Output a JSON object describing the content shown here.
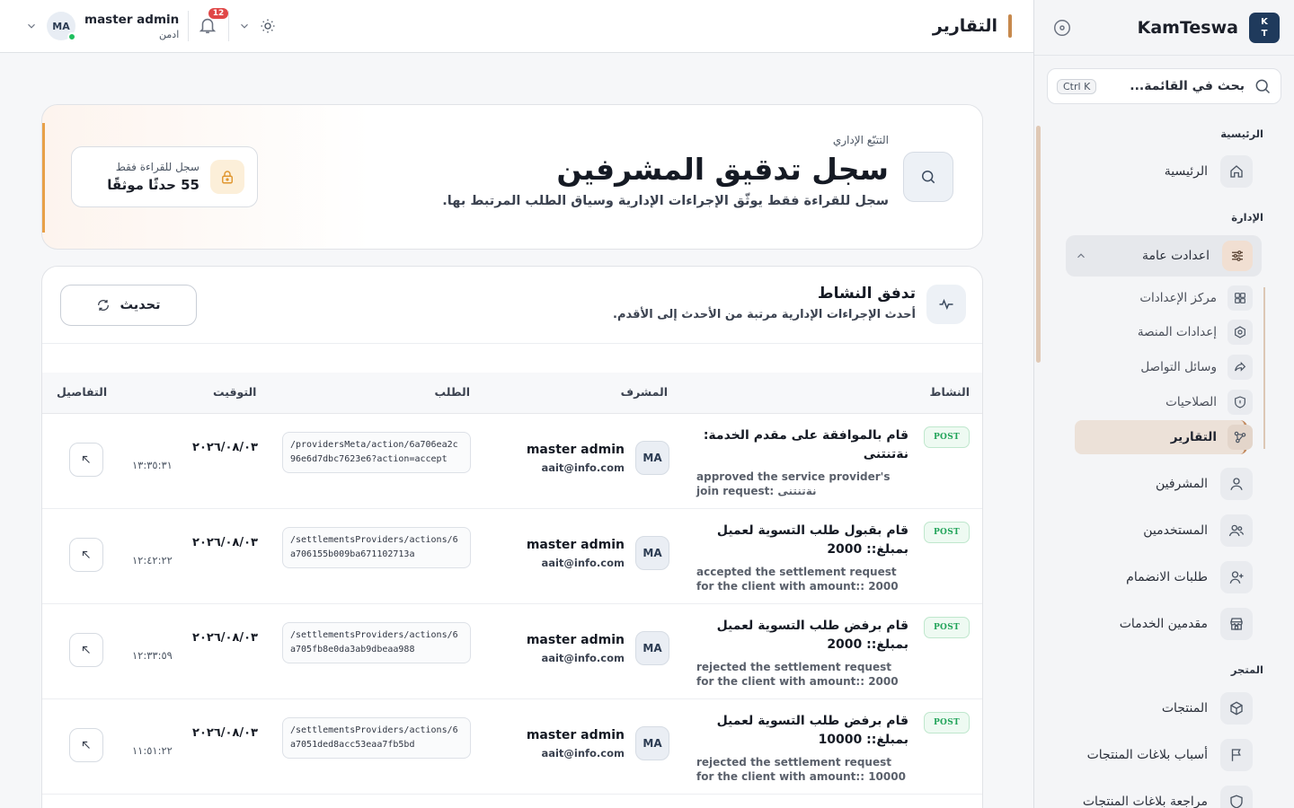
{
  "topbar": {
    "page_title": "التقارير",
    "user_initials": "MA",
    "user_name": "master admin",
    "user_role": "ادمن",
    "notifications_count": "12"
  },
  "sidebar": {
    "brand_name": "KamTeswa",
    "brand_logo_line1": "K",
    "brand_logo_line2": "T",
    "search_placeholder": "بحث في القائمة...",
    "search_shortcut": "Ctrl K",
    "section_home": "الرئيسية",
    "section_admin": "الإدارة",
    "section_store": "المتجر",
    "items": {
      "home": "الرئيسية",
      "general_settings": "اعدادت عامة",
      "settings_center": "مركز الإعدادات",
      "platform_settings": "إعدادات المنصة",
      "social": "وسائل التواصل",
      "permissions": "الصلاحيات",
      "reports": "التقارير",
      "supervisors": "المشرفين",
      "users": "المستخدمين",
      "join_requests": "طلبات الانضمام",
      "providers": "مقدمين الخدمات",
      "products": "المنتجات",
      "report_reasons": "أسباب بلاغات المنتجات",
      "report_review": "مراجعة بلاغات المنتجات"
    }
  },
  "hero": {
    "kicker": "التتبّع الإداري",
    "title": "سجل تدقيق المشرفين",
    "subtitle": "سجل للقراءة فقط يوثّق الإجراءات الإدارية وسياق الطلب المرتبط بها.",
    "chip_label": "سجل للقراءة فقط",
    "chip_value": "55 حدثًا موثقًا"
  },
  "activity": {
    "title": "تدفق النشاط",
    "subtitle": "أحدث الإجراءات الإدارية مرتبة من الأحدث إلى الأقدم.",
    "refresh_label": "تحديث",
    "columns": {
      "activity": "النشاط",
      "admin": "المشرف",
      "request": "الطلب",
      "time": "التوقيت",
      "details": "التفاصيل"
    },
    "rows": [
      {
        "method": "POST",
        "desc_ar": "قام بالموافقة على مقدم الخدمة: نةتنتنى",
        "desc_en": "approved the service provider's join request: نةتنتنى",
        "admin_initials": "MA",
        "admin_name": "master admin",
        "admin_email": "aait@info.com",
        "request": "/providersMeta/action/6a706ea2c96e6d7dbc7623e6?action=accept",
        "date": "٢٠٢٦/٠٨/٠٣",
        "time": "١٣:٣٥:٣١"
      },
      {
        "method": "POST",
        "desc_ar": "قام بقبول طلب التسوية لعميل بمبلغ:: 2000",
        "desc_en": "accepted the settlement request for the client with amount:: 2000",
        "admin_initials": "MA",
        "admin_name": "master admin",
        "admin_email": "aait@info.com",
        "request": "/settlementsProviders/actions/6a706155b009ba671102713a",
        "date": "٢٠٢٦/٠٨/٠٣",
        "time": "١٢:٤٢:٢٢"
      },
      {
        "method": "POST",
        "desc_ar": "قام برفض طلب التسوية لعميل بمبلغ:: 2000",
        "desc_en": "rejected the settlement request for the client with amount:: 2000",
        "admin_initials": "MA",
        "admin_name": "master admin",
        "admin_email": "aait@info.com",
        "request": "/settlementsProviders/actions/6a705fb8e0da3ab9dbeaa988",
        "date": "٢٠٢٦/٠٨/٠٣",
        "time": "١٢:٣٣:٥٩"
      },
      {
        "method": "POST",
        "desc_ar": "قام برفض طلب التسوية لعميل بمبلغ:: 10000",
        "desc_en": "rejected the settlement request for the client with amount:: 10000",
        "admin_initials": "MA",
        "admin_name": "master admin",
        "admin_email": "aait@info.com",
        "request": "/settlementsProviders/actions/6a7051ded8acc53eaa7fb5bd",
        "date": "٢٠٢٦/٠٨/٠٣",
        "time": "١١:٥١:٢٢"
      }
    ]
  },
  "colors": {
    "accent": "#c7894d",
    "active_nav_bg": "#ece1d8",
    "post_green": "#22a45a",
    "brand_logo_bg": "#1f3a5c"
  },
  "icons": {
    "search": "search-icon",
    "bell": "bell-icon",
    "sun": "sun-icon",
    "lock": "lock-icon",
    "activity": "activity-pulse-icon",
    "refresh": "refresh-icon",
    "details": "arrow-up-left-icon"
  }
}
